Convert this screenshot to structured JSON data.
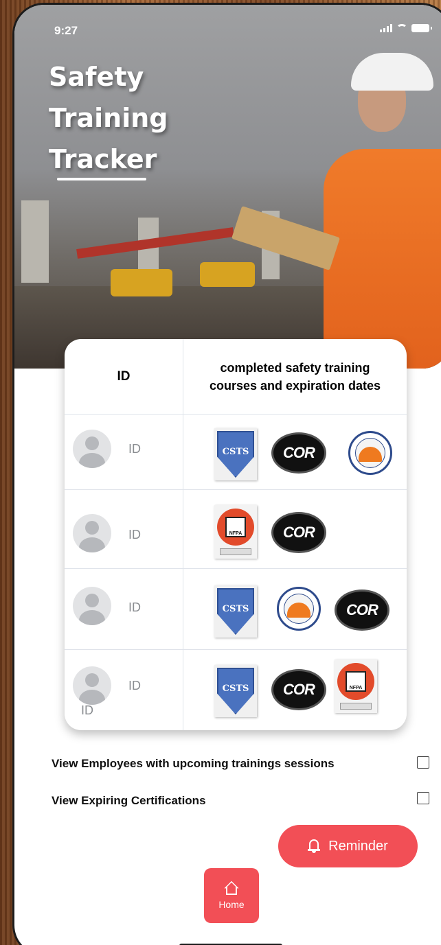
{
  "status_bar": {
    "time": "9:27"
  },
  "header": {
    "title_line1": "Safety",
    "title_line2": "Training",
    "title_line3": "Tracker"
  },
  "table": {
    "col_id": "ID",
    "col_courses": "completed safety training courses and expiration dates",
    "rows": [
      {
        "id": "ID",
        "badges": [
          "CSTS",
          "COR",
          "Construction Safety Nova Scotia"
        ]
      },
      {
        "id": "ID",
        "badges": [
          "NFPA",
          "COR"
        ]
      },
      {
        "id": "ID",
        "badges": [
          "CSTS",
          "Construction Safety Nova Scotia",
          "COR"
        ]
      },
      {
        "id": "ID",
        "sub_id": "ID",
        "badges": [
          "CSTS",
          "COR",
          "NFPA"
        ]
      }
    ],
    "badge_text": {
      "csts": "CSTS",
      "cor": "COR",
      "nfpa": "NFPA"
    }
  },
  "options": {
    "upcoming": "View Employees with upcoming trainings sessions",
    "expiring": "View Expiring Certifications"
  },
  "buttons": {
    "reminder": "Reminder",
    "home": "Home"
  },
  "colors": {
    "accent": "#f24f56",
    "vest": "#f07b2a",
    "csts_blue": "#4a72bf"
  },
  "icons": [
    "signal-icon",
    "wifi-icon",
    "battery-icon",
    "bell-icon",
    "home-icon",
    "avatar-icon"
  ]
}
